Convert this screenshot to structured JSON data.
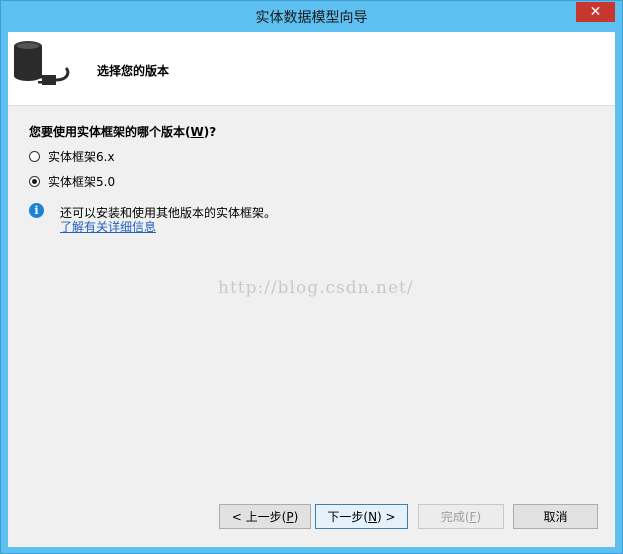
{
  "window": {
    "title": "实体数据模型向导",
    "close_symbol": "✕"
  },
  "header": {
    "title": "选择您的版本",
    "icon": "database-plug-icon"
  },
  "question": {
    "prefix": "您要使用实体框架的哪个版本(",
    "accel": "W",
    "suffix": ")?"
  },
  "options": [
    {
      "label": "实体框架6.x",
      "checked": false
    },
    {
      "label": "实体框架5.0",
      "checked": true
    }
  ],
  "info": {
    "icon": "info-icon",
    "icon_glyph": "i",
    "text": "还可以安装和使用其他版本的实体框架。",
    "link": "了解有关详细信息"
  },
  "watermark": "http://blog.csdn.net/",
  "buttons": {
    "back": {
      "prefix": "< 上一步(",
      "accel": "P",
      "suffix": ")"
    },
    "next": {
      "prefix": "下一步(",
      "accel": "N",
      "suffix": ") >"
    },
    "finish": {
      "prefix": "完成(",
      "accel": "F",
      "suffix": ")",
      "enabled": false
    },
    "cancel": {
      "label": "取消"
    }
  }
}
